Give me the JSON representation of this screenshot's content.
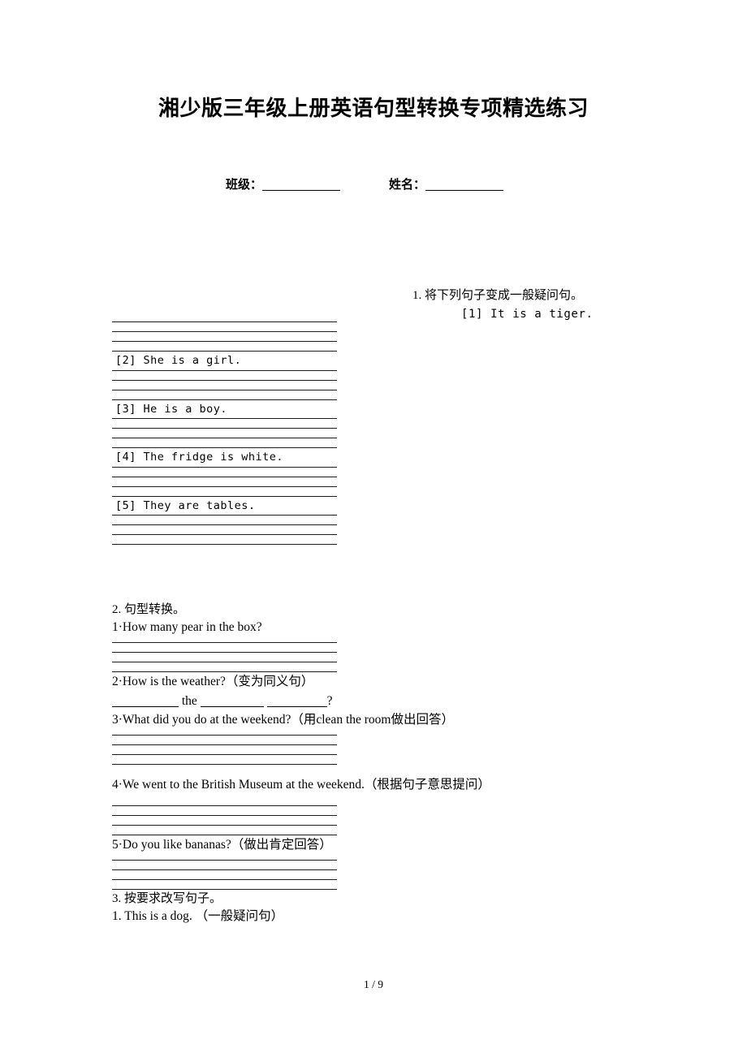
{
  "document": {
    "title": "湘少版三年级上册英语句型转换专项精选练习",
    "page_number": "1 / 9"
  },
  "info": {
    "class_label": "班级：",
    "name_label": "姓名："
  },
  "section1": {
    "heading": "1. 将下列句子变成一般疑问句。",
    "items": [
      {
        "label": "[1] It is a tiger."
      },
      {
        "label": "[2] She is a girl."
      },
      {
        "label": "[3] He is a boy."
      },
      {
        "label": "[4] The fridge is white."
      },
      {
        "label": "[5] They are tables."
      }
    ]
  },
  "section2": {
    "heading": "2. 句型转换。",
    "q1": "1·How many pear in the box?",
    "q2": "2·How is the weather?（变为同义句）",
    "q2_answer_template": "the ?",
    "q3": "3·What did you do at the weekend?（用clean the room做出回答）",
    "q4": "4·We went to the British Museum at the weekend.（根据句子意思提问）",
    "q5": "5·Do you like bananas?（做出肯定回答）"
  },
  "section3": {
    "heading": "3. 按要求改写句子。",
    "q1": "1. This is a dog. （一般疑问句）"
  }
}
